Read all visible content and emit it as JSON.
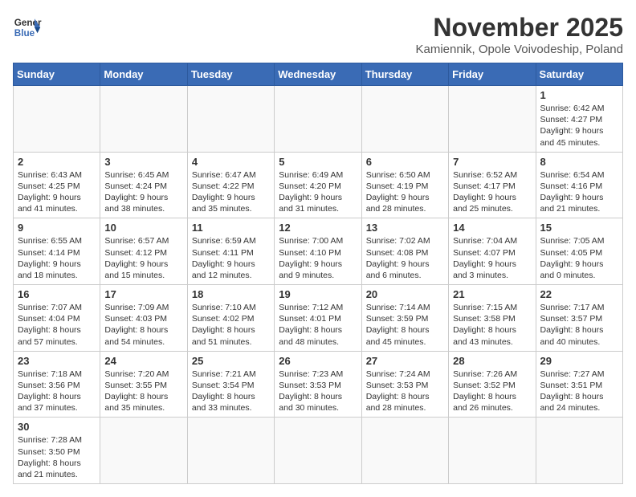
{
  "logo": {
    "line1": "General",
    "line2": "Blue"
  },
  "title": "November 2025",
  "subtitle": "Kamiennik, Opole Voivodeship, Poland",
  "weekdays": [
    "Sunday",
    "Monday",
    "Tuesday",
    "Wednesday",
    "Thursday",
    "Friday",
    "Saturday"
  ],
  "weeks": [
    [
      {
        "day": "",
        "info": ""
      },
      {
        "day": "",
        "info": ""
      },
      {
        "day": "",
        "info": ""
      },
      {
        "day": "",
        "info": ""
      },
      {
        "day": "",
        "info": ""
      },
      {
        "day": "",
        "info": ""
      },
      {
        "day": "1",
        "info": "Sunrise: 6:42 AM\nSunset: 4:27 PM\nDaylight: 9 hours\nand 45 minutes."
      }
    ],
    [
      {
        "day": "2",
        "info": "Sunrise: 6:43 AM\nSunset: 4:25 PM\nDaylight: 9 hours\nand 41 minutes."
      },
      {
        "day": "3",
        "info": "Sunrise: 6:45 AM\nSunset: 4:24 PM\nDaylight: 9 hours\nand 38 minutes."
      },
      {
        "day": "4",
        "info": "Sunrise: 6:47 AM\nSunset: 4:22 PM\nDaylight: 9 hours\nand 35 minutes."
      },
      {
        "day": "5",
        "info": "Sunrise: 6:49 AM\nSunset: 4:20 PM\nDaylight: 9 hours\nand 31 minutes."
      },
      {
        "day": "6",
        "info": "Sunrise: 6:50 AM\nSunset: 4:19 PM\nDaylight: 9 hours\nand 28 minutes."
      },
      {
        "day": "7",
        "info": "Sunrise: 6:52 AM\nSunset: 4:17 PM\nDaylight: 9 hours\nand 25 minutes."
      },
      {
        "day": "8",
        "info": "Sunrise: 6:54 AM\nSunset: 4:16 PM\nDaylight: 9 hours\nand 21 minutes."
      }
    ],
    [
      {
        "day": "9",
        "info": "Sunrise: 6:55 AM\nSunset: 4:14 PM\nDaylight: 9 hours\nand 18 minutes."
      },
      {
        "day": "10",
        "info": "Sunrise: 6:57 AM\nSunset: 4:12 PM\nDaylight: 9 hours\nand 15 minutes."
      },
      {
        "day": "11",
        "info": "Sunrise: 6:59 AM\nSunset: 4:11 PM\nDaylight: 9 hours\nand 12 minutes."
      },
      {
        "day": "12",
        "info": "Sunrise: 7:00 AM\nSunset: 4:10 PM\nDaylight: 9 hours\nand 9 minutes."
      },
      {
        "day": "13",
        "info": "Sunrise: 7:02 AM\nSunset: 4:08 PM\nDaylight: 9 hours\nand 6 minutes."
      },
      {
        "day": "14",
        "info": "Sunrise: 7:04 AM\nSunset: 4:07 PM\nDaylight: 9 hours\nand 3 minutes."
      },
      {
        "day": "15",
        "info": "Sunrise: 7:05 AM\nSunset: 4:05 PM\nDaylight: 9 hours\nand 0 minutes."
      }
    ],
    [
      {
        "day": "16",
        "info": "Sunrise: 7:07 AM\nSunset: 4:04 PM\nDaylight: 8 hours\nand 57 minutes."
      },
      {
        "day": "17",
        "info": "Sunrise: 7:09 AM\nSunset: 4:03 PM\nDaylight: 8 hours\nand 54 minutes."
      },
      {
        "day": "18",
        "info": "Sunrise: 7:10 AM\nSunset: 4:02 PM\nDaylight: 8 hours\nand 51 minutes."
      },
      {
        "day": "19",
        "info": "Sunrise: 7:12 AM\nSunset: 4:01 PM\nDaylight: 8 hours\nand 48 minutes."
      },
      {
        "day": "20",
        "info": "Sunrise: 7:14 AM\nSunset: 3:59 PM\nDaylight: 8 hours\nand 45 minutes."
      },
      {
        "day": "21",
        "info": "Sunrise: 7:15 AM\nSunset: 3:58 PM\nDaylight: 8 hours\nand 43 minutes."
      },
      {
        "day": "22",
        "info": "Sunrise: 7:17 AM\nSunset: 3:57 PM\nDaylight: 8 hours\nand 40 minutes."
      }
    ],
    [
      {
        "day": "23",
        "info": "Sunrise: 7:18 AM\nSunset: 3:56 PM\nDaylight: 8 hours\nand 37 minutes."
      },
      {
        "day": "24",
        "info": "Sunrise: 7:20 AM\nSunset: 3:55 PM\nDaylight: 8 hours\nand 35 minutes."
      },
      {
        "day": "25",
        "info": "Sunrise: 7:21 AM\nSunset: 3:54 PM\nDaylight: 8 hours\nand 33 minutes."
      },
      {
        "day": "26",
        "info": "Sunrise: 7:23 AM\nSunset: 3:53 PM\nDaylight: 8 hours\nand 30 minutes."
      },
      {
        "day": "27",
        "info": "Sunrise: 7:24 AM\nSunset: 3:53 PM\nDaylight: 8 hours\nand 28 minutes."
      },
      {
        "day": "28",
        "info": "Sunrise: 7:26 AM\nSunset: 3:52 PM\nDaylight: 8 hours\nand 26 minutes."
      },
      {
        "day": "29",
        "info": "Sunrise: 7:27 AM\nSunset: 3:51 PM\nDaylight: 8 hours\nand 24 minutes."
      }
    ],
    [
      {
        "day": "30",
        "info": "Sunrise: 7:28 AM\nSunset: 3:50 PM\nDaylight: 8 hours\nand 21 minutes."
      },
      {
        "day": "",
        "info": ""
      },
      {
        "day": "",
        "info": ""
      },
      {
        "day": "",
        "info": ""
      },
      {
        "day": "",
        "info": ""
      },
      {
        "day": "",
        "info": ""
      },
      {
        "day": "",
        "info": ""
      }
    ]
  ]
}
